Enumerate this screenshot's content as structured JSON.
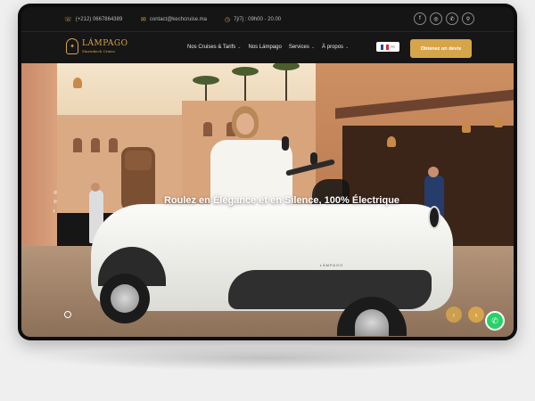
{
  "topbar": {
    "phone": "(+212) 0667864389",
    "email": "contact@kechcruise.ma",
    "hours": "7j/7j : 09h00 - 20.00",
    "phone_icon": "phone-icon",
    "email_icon": "mail-icon",
    "hours_icon": "clock-icon",
    "socials": [
      {
        "icon": "facebook-icon",
        "glyph": "f"
      },
      {
        "icon": "instagram-icon",
        "glyph": "◎"
      },
      {
        "icon": "whatsapp-icon",
        "glyph": "✆"
      },
      {
        "icon": "location-icon",
        "glyph": "⚲"
      }
    ]
  },
  "brand": {
    "name": "LÁMPAGO",
    "tagline": "Marrakech Cruise",
    "accent_color": "#d6a54a"
  },
  "nav": {
    "items": [
      {
        "label": "Nos Cruises & Tarifs",
        "has_dropdown": true
      },
      {
        "label": "Nos Lámpago",
        "has_dropdown": false
      },
      {
        "label": "Services",
        "has_dropdown": true
      },
      {
        "label": "À propos",
        "has_dropdown": true
      }
    ],
    "language": "FR",
    "cta_label": "Obtenez un devis"
  },
  "hero": {
    "headline": "Roulez en Élégance et en Silence, 100% Électrique",
    "vehicle_badge": "LÁMPAGO",
    "side_socials": [
      "instagram-icon",
      "whatsapp-icon",
      "facebook-icon"
    ],
    "prev_glyph": "‹",
    "next_glyph": "›"
  },
  "floating": {
    "whatsapp_icon": "whatsapp-icon",
    "whatsapp_color": "#25d366"
  }
}
